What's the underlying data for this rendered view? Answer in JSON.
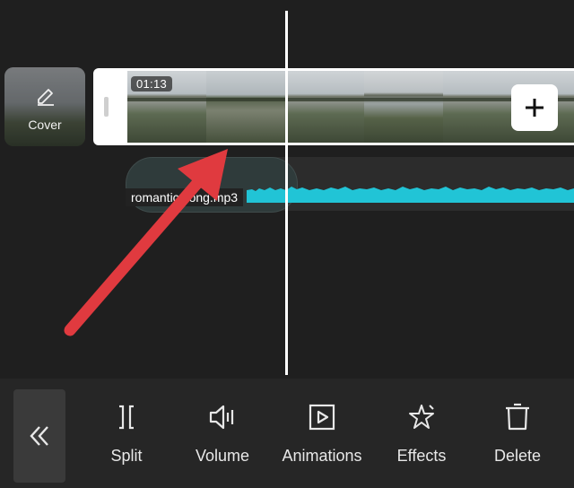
{
  "cover": {
    "label": "Cover",
    "icon": "pencil-icon"
  },
  "video_track": {
    "duration": "01:13",
    "add_icon": "plus-icon"
  },
  "audio_track": {
    "filename": "romantic song.mp3",
    "waveform_color": "#21c4d6"
  },
  "annotation": {
    "color": "#e03a3f"
  },
  "toolbar": {
    "collapse_icon": "double-chevron-left-icon",
    "tools": [
      {
        "label": "Split",
        "icon": "split-icon"
      },
      {
        "label": "Volume",
        "icon": "volume-icon"
      },
      {
        "label": "Animations",
        "icon": "animations-icon"
      },
      {
        "label": "Effects",
        "icon": "effects-icon"
      },
      {
        "label": "Delete",
        "icon": "trash-icon"
      }
    ]
  }
}
